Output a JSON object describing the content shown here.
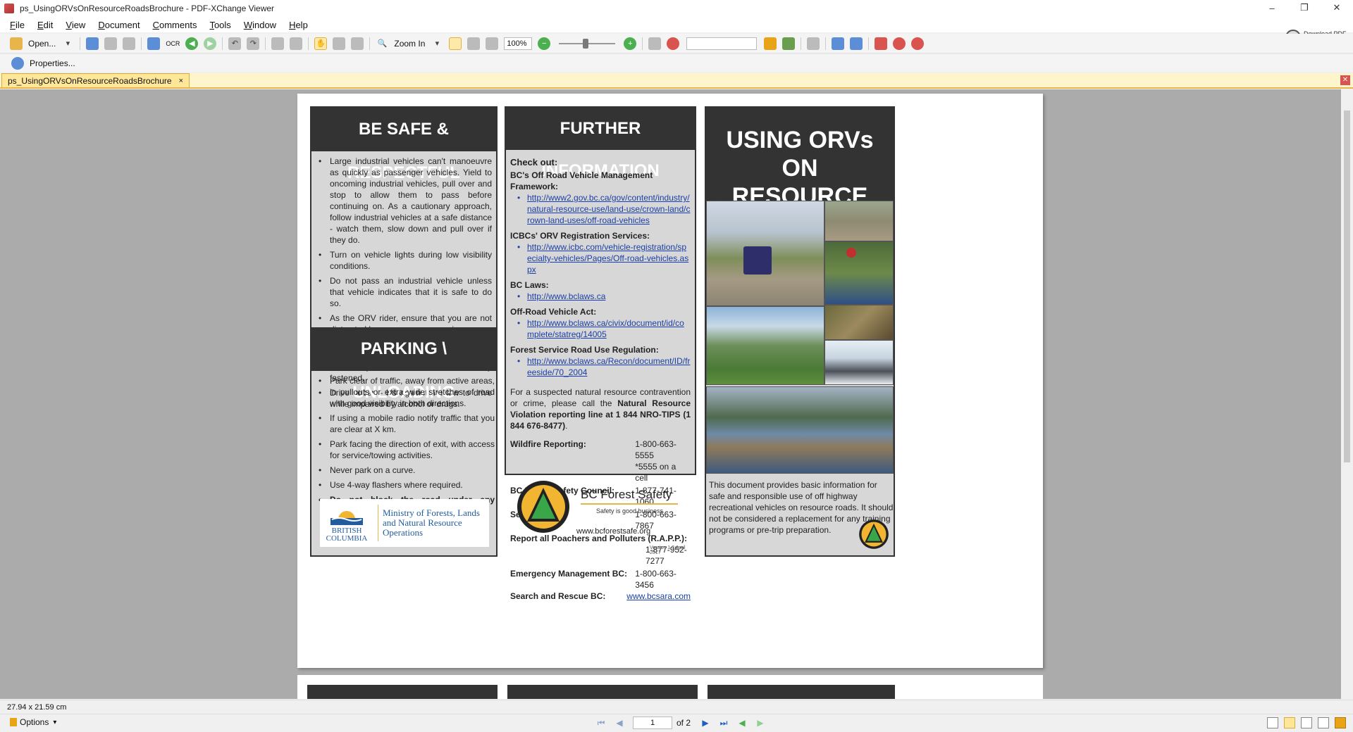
{
  "window": {
    "title": "ps_UsingORVsOnResourceRoadsBrochure - PDF-XChange Viewer",
    "controls": [
      "–",
      "❐",
      "✕"
    ]
  },
  "menu": [
    "File",
    "Edit",
    "View",
    "Document",
    "Comments",
    "Tools",
    "Window",
    "Help"
  ],
  "download_tools": "Download PDF Creation Tools",
  "toolbar": {
    "open_label": "Open...",
    "ocr_label": "OCR",
    "zoom_in_label": "Zoom In",
    "zoom_value": "100%",
    "properties_label": "Properties..."
  },
  "tab": {
    "label": "ps_UsingORVsOnResourceRoadsBrochure",
    "close": "×"
  },
  "brochure": {
    "left": {
      "heading1": "BE SAFE & RESPECTFUL",
      "safe_items": [
        "Large industrial vehicles can't manoeuvre as quickly as passenger vehicles. Yield to oncoming industrial vehicles, pull over and stop to allow them to pass before continuing on. As a cautionary approach, follow industrial vehicles at a safe distance - watch them, slow down and pull over if they do.",
        "Turn on vehicle lights during low visibility conditions.",
        "Do not pass an industrial vehicle unless that vehicle indicates that it is safe to do so.",
        "As the ORV rider, ensure that you are not distracted by passengers or music.",
        "Wear your safety equipment at all times and, if installed by the manufacturer, ensure your seatbelts are securely fastened.",
        "Drive sober – it's against the law to drive while impaired by alcohol or drugs."
      ],
      "heading2": "PARKING \\ UNLOADING",
      "parking_items": [
        "Park clear of traffic, away from active areas, in pullouts or extra wide stretches of road with good visibility in both directions.",
        "If using a mobile radio notify traffic that you are clear at X km.",
        "Park facing the direction of exit, with access for service/towing activities.",
        "Never park on a curve.",
        "Use 4-way flashers where required.",
        "Do not block the road under any circumstances."
      ],
      "logo_left": "BRITISH COLUMBIA",
      "logo_ministry": "Ministry of Forests, Lands and Natural Resource Operations"
    },
    "middle": {
      "heading": "FURTHER INFORMATION",
      "checkout": "Check out:",
      "links": [
        {
          "label": "BC's Off Road Vehicle Management Framework:",
          "url": "http://www2.gov.bc.ca/gov/content/industry/natural-resource-use/land-use/crown-land/crown-land-uses/off-road-vehicles"
        },
        {
          "label": "ICBCs' ORV Registration Services:",
          "url": "http://www.icbc.com/vehicle-registration/specialty-vehicles/Pages/Off-road-vehicles.aspx"
        },
        {
          "label": "BC Laws:",
          "url": "http://www.bclaws.ca"
        },
        {
          "label": "Off-Road Vehicle Act:",
          "url": "http://www.bclaws.ca/civix/document/id/complete/statreg/14005"
        },
        {
          "label": "Forest Service Road Use Regulation:",
          "url": "http://www.bclaws.ca/Recon/document/ID/freeside/70_2004"
        }
      ],
      "contravention_pre": "For a suspected natural resource contravention or crime, please call the ",
      "contravention_bold": "Natural Resource Violation reporting line at 1 844 NRO-TIPS (1 844 676-8477)",
      "contravention_post": ".",
      "contacts": [
        {
          "label": "Wildfire Reporting:",
          "value": "1-800-663-5555",
          "value2": "*5555 on a cell"
        },
        {
          "label": "BC Forest Safety Council:",
          "value": "1-877-741-1060"
        },
        {
          "label": "Service BC:",
          "value": "1-800-663-7867"
        },
        {
          "label": "Report all Poachers and Polluters (R.A.P.P.):",
          "value": "1-877-952-7277"
        },
        {
          "label": "Emergency Management BC:",
          "value": "1-800-663-3456"
        },
        {
          "label": "Search and Rescue BC:",
          "value": "www.bcsara.com"
        }
      ],
      "bcfs_name": "BC Forest Safety",
      "bcfs_tagline": "Safety is good business",
      "bcfs_url": "www.bcforestsafe.org",
      "version": "Version 1.3  April 2017"
    },
    "right": {
      "heading": "USING ORVs ON RESOURCE ROADS",
      "description": "This document provides basic information for safe and responsible use of off highway recreational vehicles on resource roads. It should not be considered a replacement for any training programs or pre-trip preparation."
    }
  },
  "status": {
    "page_size": "27.94 x 21.59 cm"
  },
  "bottom": {
    "options_label": "Options",
    "page_current": "1",
    "page_total": "of 2"
  },
  "colors": {
    "accent": "#e8b54a",
    "panel_head": "#333333",
    "link": "#1a3fa8",
    "viewer_bg": "#ababab"
  }
}
